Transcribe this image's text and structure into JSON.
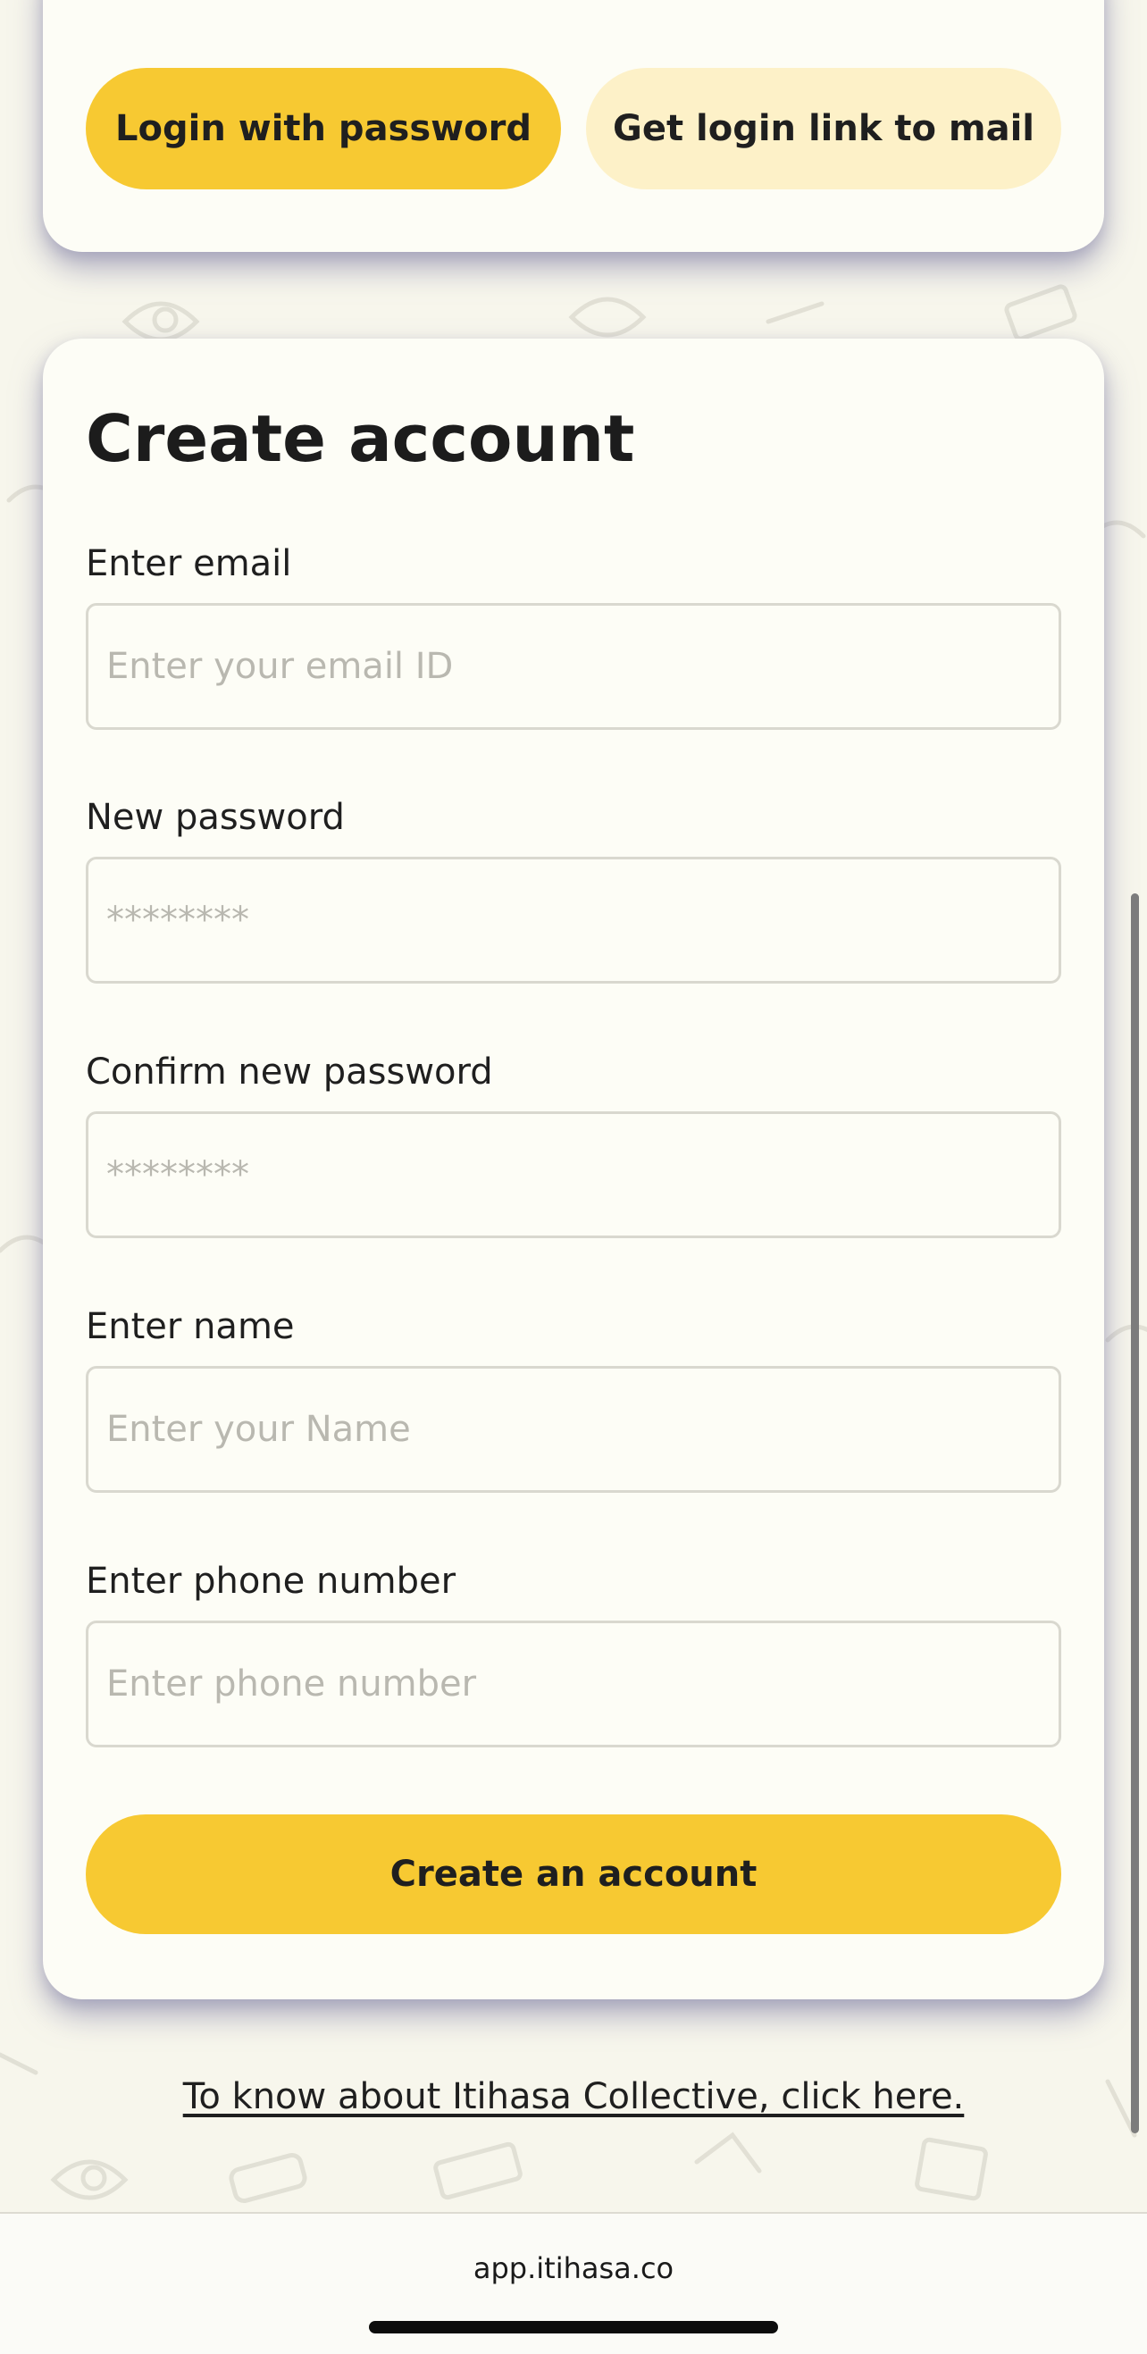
{
  "login_card": {
    "password_button": "Login with password",
    "link_button": "Get login link to mail"
  },
  "signup": {
    "title": "Create account",
    "fields": [
      {
        "label": "Enter email",
        "placeholder": "Enter your email ID",
        "value": ""
      },
      {
        "label": "New password",
        "placeholder": "********",
        "value": ""
      },
      {
        "label": "Confirm new password",
        "placeholder": "********",
        "value": ""
      },
      {
        "label": "Enter name",
        "placeholder": "Enter your Name",
        "value": ""
      },
      {
        "label": "Enter phone number",
        "placeholder": "Enter phone number",
        "value": ""
      }
    ],
    "submit_button": "Create an account"
  },
  "footer_link": "To know about Itihasa Collective, click here.",
  "browser": {
    "url": "app.itihasa.co"
  },
  "colors": {
    "accent": "#f7c932",
    "accent_light": "#fdf1c8",
    "background": "#f7f6ec",
    "card": "#fdfdf6"
  }
}
